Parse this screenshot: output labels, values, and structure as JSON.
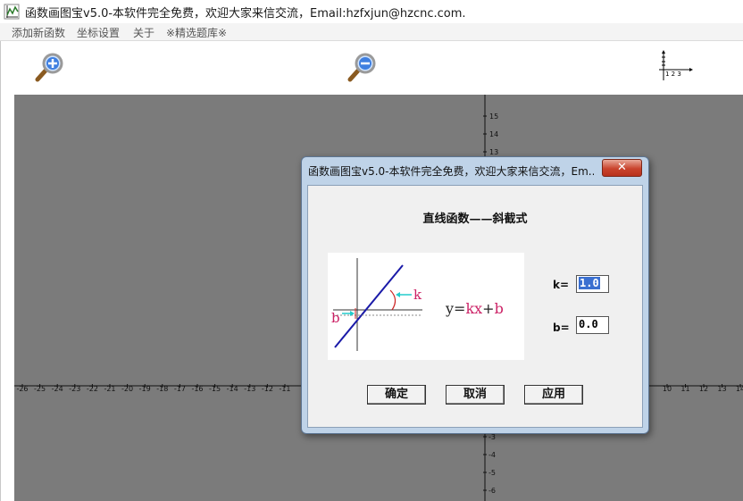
{
  "window": {
    "title": "函数画图宝v5.0-本软件完全免费，欢迎大家来信交流，Email:hzfxjun@hzcnc.com."
  },
  "menu": {
    "items": [
      "添加新函数",
      "坐标设置",
      "关于",
      "※精选题库※"
    ]
  },
  "toolbar": {
    "zoom_in_icon": "zoom-in-icon",
    "zoom_out_icon": "zoom-out-icon",
    "axes_icon": "axes-icon",
    "axes_icon_ticks": "1 2 3"
  },
  "graph": {
    "x_ticks_left": [
      "-26",
      "-25",
      "-24",
      "-23",
      "-22",
      "-21",
      "-20",
      "-19",
      "-18",
      "-17",
      "-16",
      "-15",
      "-14",
      "-13",
      "-12",
      "-11"
    ],
    "x_ticks_right": [
      "10",
      "11",
      "12",
      "13",
      "14"
    ],
    "y_ticks_top": [
      "15",
      "14",
      "13"
    ],
    "y_ticks_bottom": [
      "-3",
      "-4",
      "-5",
      "-6"
    ]
  },
  "dialog": {
    "title": "函数画图宝v5.0-本软件完全免费，欢迎大家来信交流，Em...",
    "close_label": "✕",
    "heading": "直线函数——斜截式",
    "diagram": {
      "k_label": "k",
      "b_label": "b",
      "formula_prefix": "y=",
      "formula_k": "kx",
      "formula_plus": "+",
      "formula_b": "b"
    },
    "k_label": "k=",
    "k_value": "1.0",
    "b_label": "b=",
    "b_value": "0.0",
    "ok_label": "确定",
    "cancel_label": "取消",
    "apply_label": "应用"
  },
  "colors": {
    "canvas_bg": "#7b7b7b",
    "line_blue": "#1a1aa8",
    "accent_pink": "#cc2266",
    "accent_cyan": "#22cccc",
    "dialog_frame": "#bfd3e8",
    "selection": "#3a6fd0"
  }
}
